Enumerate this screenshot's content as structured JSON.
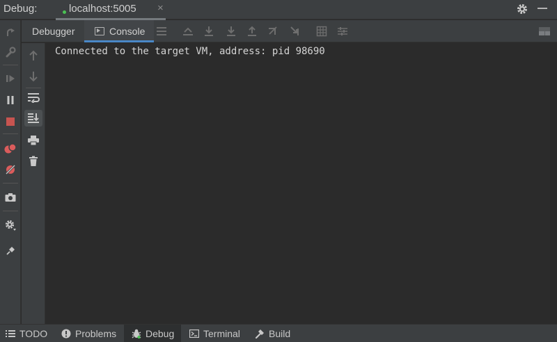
{
  "title_bar": {
    "label": "Debug:",
    "run_tab": "localhost:5005",
    "close_glyph": "×",
    "actions": [
      "gear-icon",
      "minimize-icon"
    ]
  },
  "left_toolbar": {
    "icons": [
      "rerun-icon",
      "settings-wrench-icon",
      "resume-icon",
      "pause-icon",
      "stop-icon",
      "view-breakpoints-icon",
      "mute-breakpoints-icon",
      "screenshot-icon",
      "settings-icon",
      "pin-icon"
    ]
  },
  "tabs": [
    {
      "label": "Debugger",
      "active": false
    },
    {
      "label": "Console",
      "active": true
    }
  ],
  "console": {
    "lines": [
      "Connected to the target VM, address: pid 98690"
    ]
  },
  "bottom_bar": {
    "items": [
      {
        "label": "TODO",
        "icon": "list-icon",
        "active": false
      },
      {
        "label": "Problems",
        "icon": "warning-icon",
        "active": false
      },
      {
        "label": "Debug",
        "icon": "bug-icon",
        "active": true
      },
      {
        "label": "Terminal",
        "icon": "terminal-icon",
        "active": false
      },
      {
        "label": "Build",
        "icon": "hammer-icon",
        "active": false
      }
    ]
  },
  "colors": {
    "panel": "#3c3f41",
    "editor": "#2b2b2b",
    "accent": "#4a88c7",
    "stop": "#c75450",
    "running": "#4bc254"
  }
}
